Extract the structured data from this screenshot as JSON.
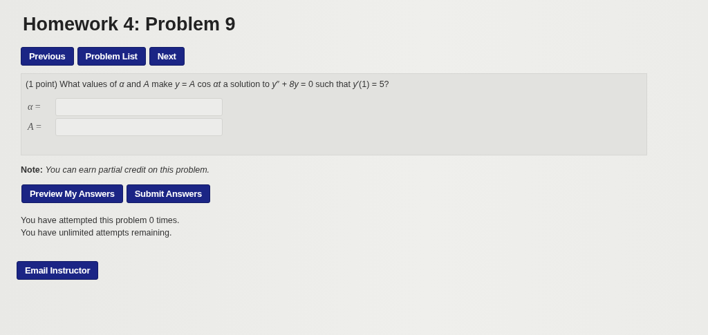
{
  "title": "Homework 4: Problem 9",
  "nav_buttons": [
    "Previous",
    "Problem List",
    "Next"
  ],
  "problem": {
    "question": "(1 point) What values of *α* and *A* make *y* = *A* cos *αt* a solution to *y*″ + *8y* = 0 such that *y*′(1) = 5?",
    "answers": [
      {
        "label": "*α* ="
      },
      {
        "label": "*A* ="
      }
    ]
  },
  "note": "**Note:** *You can earn partial credit on this problem.*",
  "action_buttons": [
    "Preview My Answers",
    "Submit Answers"
  ],
  "attempts": [
    "You have attempted this problem 0 times.",
    "You have unlimited attempts remaining."
  ],
  "email_button": "Email Instructor"
}
